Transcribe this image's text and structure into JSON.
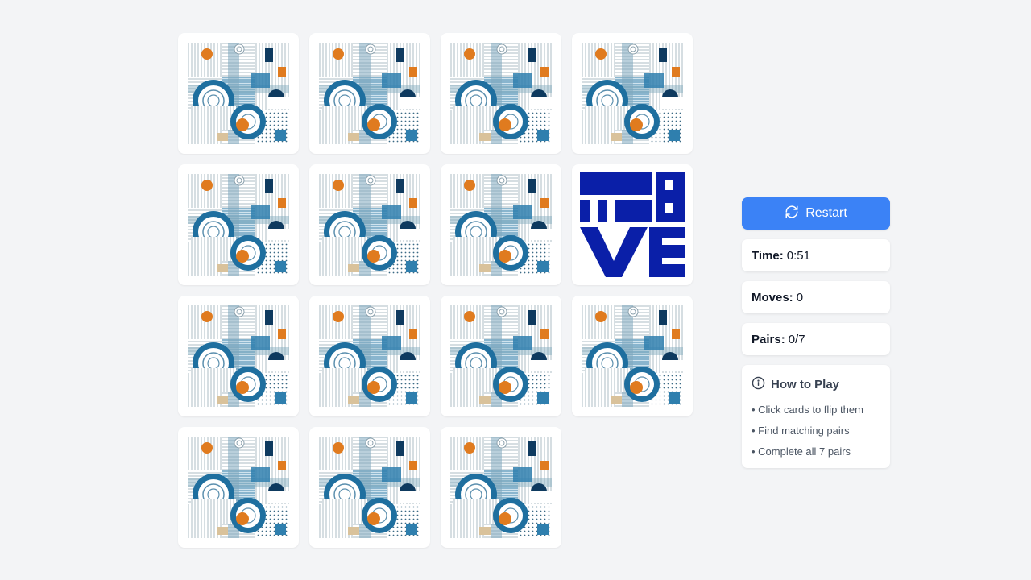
{
  "board": {
    "cards": [
      {
        "state": "hidden"
      },
      {
        "state": "hidden"
      },
      {
        "state": "hidden"
      },
      {
        "state": "hidden"
      },
      {
        "state": "hidden"
      },
      {
        "state": "hidden"
      },
      {
        "state": "hidden"
      },
      {
        "state": "revealed",
        "face": "MOVE"
      },
      {
        "state": "hidden"
      },
      {
        "state": "hidden"
      },
      {
        "state": "hidden"
      },
      {
        "state": "hidden"
      },
      {
        "state": "hidden"
      },
      {
        "state": "hidden"
      },
      {
        "state": "hidden"
      }
    ],
    "revealed_logo_color": "#0a1fa8"
  },
  "sidebar": {
    "restart_label": "Restart",
    "restart_icon": "refresh-icon",
    "time_label": "Time:",
    "time_value": "0:51",
    "moves_label": "Moves:",
    "moves_value": "0",
    "pairs_label": "Pairs:",
    "pairs_value": "0/7",
    "howto_title": "How to Play",
    "howto_icon": "info-icon",
    "howto_items": [
      "• Click cards to flip them",
      "• Find matching pairs",
      "• Complete all 7 pairs"
    ]
  },
  "colors": {
    "background": "#f3f4f6",
    "accent": "#3b82f6",
    "card_pattern_blue": "#1f6f9f",
    "card_pattern_orange": "#e07b1f",
    "card_pattern_navy": "#0e3a5f"
  }
}
